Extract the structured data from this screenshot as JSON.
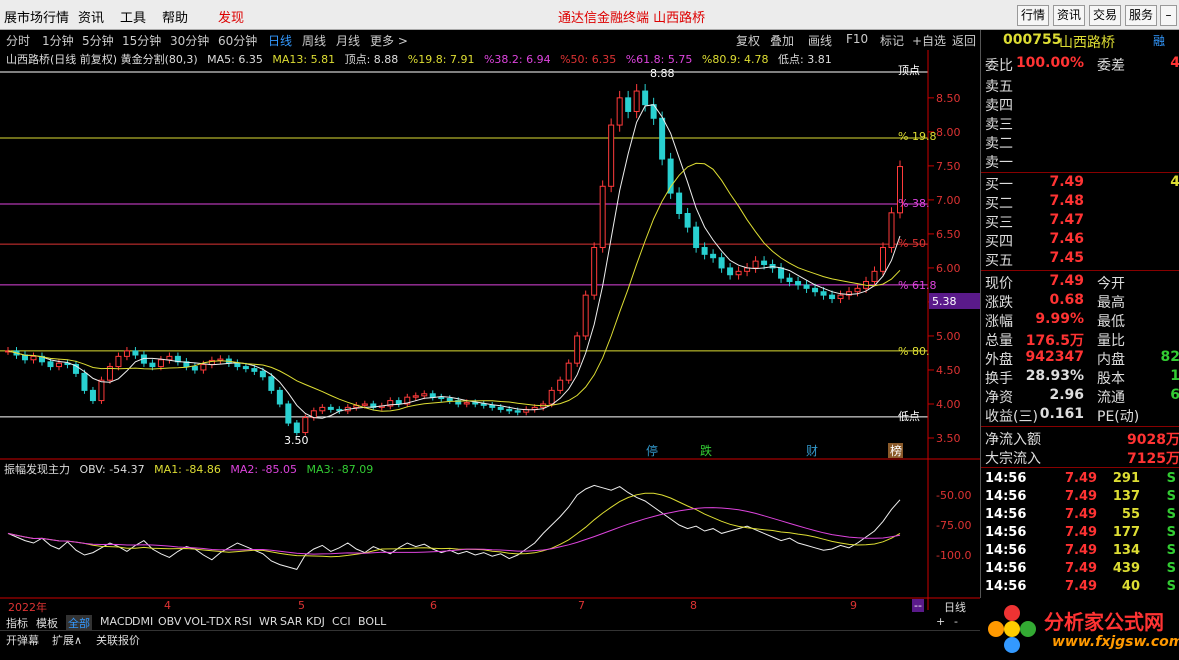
{
  "menubar": {
    "items": [
      "展市场行情",
      "资讯",
      "工具",
      "帮助",
      "发现"
    ],
    "title": "通达信金融终端  山西路桥",
    "right_buttons": [
      "行情",
      "资讯",
      "交易",
      "服务"
    ]
  },
  "toolbar": {
    "periods": [
      "分时",
      "1分钟",
      "5分钟",
      "15分钟",
      "30分钟",
      "60分钟",
      "日线",
      "周线",
      "月线",
      "更多 >"
    ],
    "active": "日线",
    "actions": [
      "复权",
      "叠加",
      "画线",
      "F10",
      "标记",
      "+自选",
      "返回"
    ]
  },
  "info": {
    "name": "山西路桥(日线 前复权) 黄金分割(80,3)",
    "ma5": "MA5: 6.35",
    "ma13": "MA13: 5.81",
    "top": "顶点: 8.88",
    "f19": "%19.8: 7.91",
    "f38": "%38.2: 6.94",
    "f50": "%50: 6.35",
    "f61": "%61.8: 5.75",
    "f80": "%80.9: 4.78",
    "low": "低点: 3.81"
  },
  "chart_labels": {
    "high": "8.88",
    "low": "3.50",
    "top_tag": "顶点",
    "low_tag": "低点",
    "f19_tag": "% 19.8",
    "f38_tag": "% 38.",
    "f50_tag": "% 50",
    "f61_tag": "% 61.8",
    "f80_tag": "% 80.",
    "cursor_price": "5.38"
  },
  "price_axis": [
    "8.50",
    "8.00",
    "7.50",
    "7.00",
    "6.50",
    "6.00",
    "5.50",
    "5.00",
    "4.50",
    "4.00",
    "3.50"
  ],
  "events": [
    "停",
    "跌",
    "财",
    "榜"
  ],
  "obv": {
    "name": "振幅发现主力",
    "obv": "OBV: -54.37",
    "ma1": "MA1: -84.86",
    "ma2": "MA2: -85.05",
    "ma3": "MA3: -87.09",
    "axis": [
      "-50.00",
      "-75.00",
      "-100.0"
    ]
  },
  "time_axis": [
    "2022年",
    "4",
    "5",
    "6",
    "7",
    "8",
    "9"
  ],
  "bottom": {
    "tabs": [
      "指标",
      "模板",
      "全部",
      "MACD",
      "DMI",
      "OBV",
      "VOL-TDX",
      "RSI",
      "WR",
      "SAR",
      "KDJ",
      "CCI",
      "BOLL"
    ],
    "tabs2": [
      "开弹幕",
      "扩展∧",
      "关联报价"
    ],
    "period_label": "日线",
    "dash": "--"
  },
  "quote": {
    "code": "000755",
    "name": "山西路桥",
    "tag": "融",
    "weibi_label": "委比",
    "weibi": "100.00%",
    "weicha_label": "委差",
    "weicha": "4",
    "sell": [
      "卖五",
      "卖四",
      "卖三",
      "卖二",
      "卖一"
    ],
    "buy": [
      {
        "l": "买一",
        "p": "7.49",
        "q": "4"
      },
      {
        "l": "买二",
        "p": "7.48",
        "q": ""
      },
      {
        "l": "买三",
        "p": "7.47",
        "q": ""
      },
      {
        "l": "买四",
        "p": "7.46",
        "q": ""
      },
      {
        "l": "买五",
        "p": "7.45",
        "q": ""
      }
    ],
    "stats": [
      {
        "l": "现价",
        "v": "7.49",
        "l2": "今开",
        "v2": ""
      },
      {
        "l": "涨跌",
        "v": "0.68",
        "l2": "最高",
        "v2": ""
      },
      {
        "l": "涨幅",
        "v": "9.99%",
        "l2": "最低",
        "v2": ""
      },
      {
        "l": "总量",
        "v": "176.5万",
        "l2": "量比",
        "v2": ""
      },
      {
        "l": "外盘",
        "v": "942347",
        "l2": "内盘",
        "v2": "82"
      },
      {
        "l": "换手",
        "v": "28.93%",
        "l2": "股本",
        "v2": "1"
      },
      {
        "l": "净资",
        "v": "2.96",
        "l2": "流通",
        "v2": "6"
      },
      {
        "l": "收益(三)",
        "v": "0.161",
        "l2": "PE(动)",
        "v2": ""
      }
    ],
    "flow": [
      {
        "l": "净流入额",
        "v": "9028万"
      },
      {
        "l": "大宗流入",
        "v": "7125万"
      }
    ],
    "trades": [
      {
        "t": "14:56",
        "p": "7.49",
        "q": "291",
        "s": "S"
      },
      {
        "t": "14:56",
        "p": "7.49",
        "q": "137",
        "s": "S"
      },
      {
        "t": "14:56",
        "p": "7.49",
        "q": "55",
        "s": "S"
      },
      {
        "t": "14:56",
        "p": "7.49",
        "q": "177",
        "s": "S"
      },
      {
        "t": "14:56",
        "p": "7.49",
        "q": "134",
        "s": "S"
      },
      {
        "t": "14:56",
        "p": "7.49",
        "q": "439",
        "s": "S"
      },
      {
        "t": "14:56",
        "p": "7.49",
        "q": "40",
        "s": "S"
      }
    ]
  },
  "logo": {
    "cn": "分析家公式网",
    "url": "www.fxjgsw.com"
  },
  "series": {
    "start_price": 4.78,
    "closes": [
      4.78,
      4.72,
      4.65,
      4.7,
      4.62,
      4.55,
      4.6,
      4.58,
      4.45,
      4.2,
      4.05,
      4.35,
      4.55,
      4.7,
      4.78,
      4.72,
      4.6,
      4.55,
      4.65,
      4.7,
      4.62,
      4.55,
      4.5,
      4.58,
      4.64,
      4.66,
      4.6,
      4.55,
      4.52,
      4.48,
      4.4,
      4.2,
      4.0,
      3.72,
      3.58,
      3.8,
      3.9,
      3.95,
      3.92,
      3.9,
      3.95,
      3.98,
      4.0,
      3.95,
      3.97,
      4.05,
      4.0,
      4.1,
      4.12,
      4.15,
      4.1,
      4.08,
      4.05,
      4.0,
      4.02,
      4.0,
      3.98,
      3.95,
      3.92,
      3.9,
      3.88,
      3.92,
      3.95,
      4.0,
      4.2,
      4.35,
      4.6,
      5.0,
      5.6,
      6.3,
      7.2,
      8.1,
      8.5,
      8.3,
      8.6,
      8.4,
      8.2,
      7.6,
      7.1,
      6.8,
      6.6,
      6.3,
      6.2,
      6.15,
      6.0,
      5.9,
      5.95,
      6.0,
      6.1,
      6.05,
      6.0,
      5.85,
      5.8,
      5.75,
      5.7,
      5.65,
      5.6,
      5.55,
      5.6,
      5.65,
      5.7,
      5.8,
      5.95,
      6.3,
      6.81,
      7.49
    ],
    "obv": [
      -82,
      -85,
      -88,
      -90,
      -86,
      -92,
      -95,
      -89,
      -96,
      -100,
      -98,
      -94,
      -90,
      -93,
      -97,
      -92,
      -88,
      -95,
      -99,
      -102,
      -97,
      -93,
      -95,
      -100,
      -104,
      -98,
      -94,
      -90,
      -93,
      -96,
      -99,
      -105,
      -108,
      -110,
      -112,
      -100,
      -95,
      -92,
      -97,
      -94,
      -90,
      -95,
      -98,
      -93,
      -96,
      -99,
      -94,
      -90,
      -93,
      -91,
      -95,
      -98,
      -96,
      -99,
      -97,
      -100,
      -98,
      -101,
      -99,
      -103,
      -100,
      -95,
      -90,
      -82,
      -75,
      -68,
      -60,
      -50,
      -45,
      -42,
      -44,
      -46,
      -43,
      -48,
      -52,
      -55,
      -60,
      -65,
      -70,
      -75,
      -78,
      -76,
      -80,
      -78,
      -82,
      -80,
      -78,
      -76,
      -79,
      -82,
      -85,
      -88,
      -86,
      -90,
      -92,
      -94,
      -96,
      -95,
      -92,
      -94,
      -90,
      -85,
      -80,
      -72,
      -62,
      -54
    ]
  }
}
